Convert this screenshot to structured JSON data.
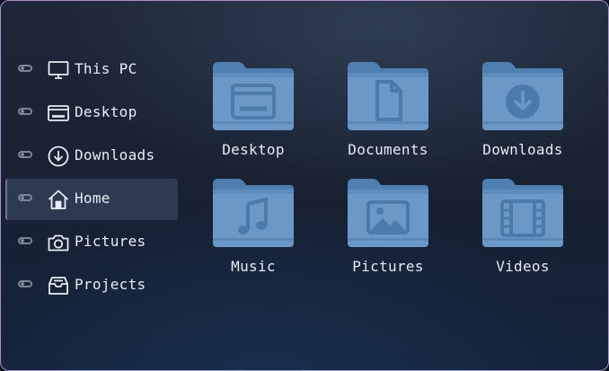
{
  "colors": {
    "folder_body": "#6b98c7",
    "folder_tab": "#4f7fb1",
    "folder_glyph": "#4c7bab",
    "sidebar_icon": "#e8ecf3",
    "window_border": "#a88fc4"
  },
  "sidebar": {
    "items": [
      {
        "label": "This PC",
        "icon": "monitor-icon",
        "active": false
      },
      {
        "label": "Desktop",
        "icon": "desktop-window-icon",
        "active": false
      },
      {
        "label": "Downloads",
        "icon": "download-circle-icon",
        "active": false
      },
      {
        "label": "Home",
        "icon": "home-icon",
        "active": true
      },
      {
        "label": "Pictures",
        "icon": "camera-icon",
        "active": false
      },
      {
        "label": "Projects",
        "icon": "inbox-tray-icon",
        "active": false
      }
    ]
  },
  "folders": [
    {
      "label": "Desktop",
      "icon": "desktop-window-icon"
    },
    {
      "label": "Documents",
      "icon": "document-icon"
    },
    {
      "label": "Downloads",
      "icon": "download-circle-icon"
    },
    {
      "label": "Music",
      "icon": "music-note-icon"
    },
    {
      "label": "Pictures",
      "icon": "image-icon"
    },
    {
      "label": "Videos",
      "icon": "film-icon"
    }
  ]
}
